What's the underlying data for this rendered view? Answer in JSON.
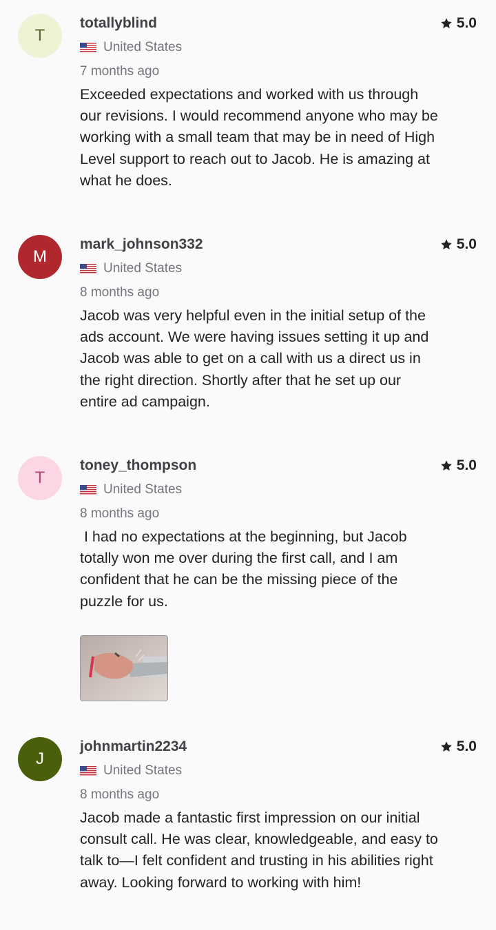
{
  "reviews": [
    {
      "avatar_initial": "T",
      "avatar_bg": "#eff2d5",
      "avatar_fg": "#556b2f",
      "username": "totallyblind",
      "rating": "5.0",
      "country": "United States",
      "time": "7 months ago",
      "text": "Exceeded expectations and worked with us through\nour revisions. I would recommend anyone who may be\nworking with a small team that may be in need of High\nLevel support to reach out to Jacob. He is amazing at\nwhat he does."
    },
    {
      "avatar_initial": "M",
      "avatar_bg": "#b0282e",
      "avatar_fg": "#ffffff",
      "username": "mark_johnson332",
      "rating": "5.0",
      "country": "United States",
      "time": "8 months ago",
      "text": "Jacob was very helpful even in the initial setup of the\nads account. We were having issues setting it up and\nJacob was able to get on a call with us a direct us in\nthe right direction. Shortly after that he set up our\nentire ad campaign."
    },
    {
      "avatar_initial": "T",
      "avatar_bg": "#fcd6e4",
      "avatar_fg": "#b04b7a",
      "username": "toney_thompson",
      "rating": "5.0",
      "country": "United States",
      "time": "8 months ago",
      "text": " I had no expectations at the beginning, but Jacob\ntotally won me over during the first call, and I am\nconfident that he can be the missing piece of the\npuzzle for us.",
      "has_attachment": true
    },
    {
      "avatar_initial": "J",
      "avatar_bg": "#4a5f0a",
      "avatar_fg": "#ffffff",
      "username": "johnmartin2234",
      "rating": "5.0",
      "country": "United States",
      "time": "8 months ago",
      "text": "Jacob made a fantastic first impression on our initial\nconsult call. He was clear, knowledgeable, and easy to\ntalk to—I felt confident and trusting in his abilities right\naway. Looking forward to working with him!"
    }
  ]
}
